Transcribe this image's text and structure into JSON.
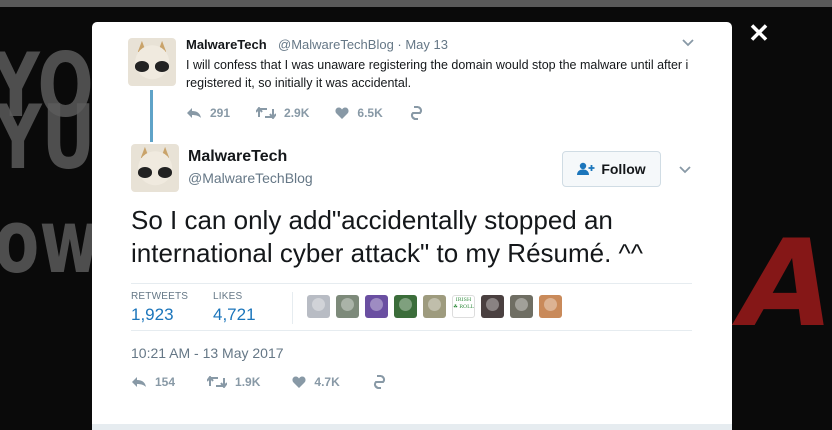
{
  "previous_tweet": {
    "author_name": "MalwareTech",
    "author_handle": "@MalwareTechBlog · May 13",
    "text": "I will confess that I was unaware registering the domain would stop the malware until after i registered it, so initially it was accidental.",
    "reply_count": "291",
    "retweet_count": "2.9K",
    "like_count": "6.5K"
  },
  "main_tweet": {
    "author_name": "MalwareTech",
    "author_handle": "@MalwareTechBlog",
    "follow_label": "Follow",
    "text": "So I can only add\"accidentally stopped an international cyber attack\" to my Résumé. ^^",
    "retweets_label": "RETWEETS",
    "retweets_value": "1,923",
    "likes_label": "LIKES",
    "likes_value": "4,721",
    "timestamp": "10:21 AM - 13 May 2017",
    "reply_count": "154",
    "retweet_count": "1.9K",
    "like_count": "4.7K"
  },
  "liker_avatars": [
    {
      "name": "liker-avatar-1",
      "color": "#b8bcc4"
    },
    {
      "name": "liker-avatar-2",
      "color": "#7d8a7a"
    },
    {
      "name": "liker-avatar-3",
      "color": "#6a4fa1"
    },
    {
      "name": "liker-avatar-4",
      "color": "#3b6d3a"
    },
    {
      "name": "liker-avatar-5",
      "color": "#9e9b7e"
    },
    {
      "name": "liker-avatar-6",
      "color": "#2e8b3a",
      "text": "IRISH ☘ ROLL"
    },
    {
      "name": "liker-avatar-7",
      "color": "#4a4040"
    },
    {
      "name": "liker-avatar-8",
      "color": "#6f6e63"
    },
    {
      "name": "liker-avatar-9",
      "color": "#c98a5a"
    }
  ],
  "colors": {
    "link_blue": "#1b75bb",
    "icon_grey": "#8899a6",
    "thread_line": "#5fa3c8",
    "background_red": "#9b1a1a"
  },
  "icons": {
    "close": "close-icon",
    "reply": "reply-icon",
    "retweet": "retweet-icon",
    "like": "heart-icon",
    "moments": "moments-icon",
    "follow": "follow-person-icon",
    "caret": "chevron-down-icon"
  }
}
